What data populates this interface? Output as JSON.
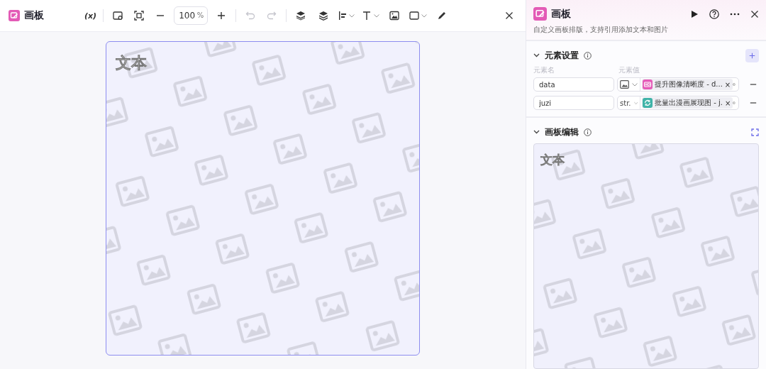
{
  "editor": {
    "title": "画板",
    "variable_button": "(x)",
    "zoom": {
      "value": "100",
      "unit": "%"
    },
    "undo_disabled": true,
    "redo_disabled": true,
    "canvas": {
      "text": "文本"
    }
  },
  "panel": {
    "title": "画板",
    "description": "自定义画板排版，支持引用添加文本和图片",
    "elements_section": {
      "title": "元素设置",
      "expanded": true,
      "name_column": "元素名",
      "value_column": "元素值",
      "rows": [
        {
          "name": "data",
          "type": {
            "kind": "image"
          },
          "reference": {
            "kind": "hd",
            "color": "#e55bb8",
            "label": "提升图像清晰度 - d...",
            "remove_symbol": "×"
          }
        },
        {
          "name": "juzi",
          "type": {
            "kind": "text",
            "label": "str."
          },
          "reference": {
            "kind": "loop",
            "color": "#3fb3a8",
            "label": "批量出漫画展现图 - j.",
            "remove_symbol": "×"
          }
        }
      ]
    },
    "board_section": {
      "title": "画板编辑",
      "expanded": true,
      "preview_text": "文本"
    }
  }
}
